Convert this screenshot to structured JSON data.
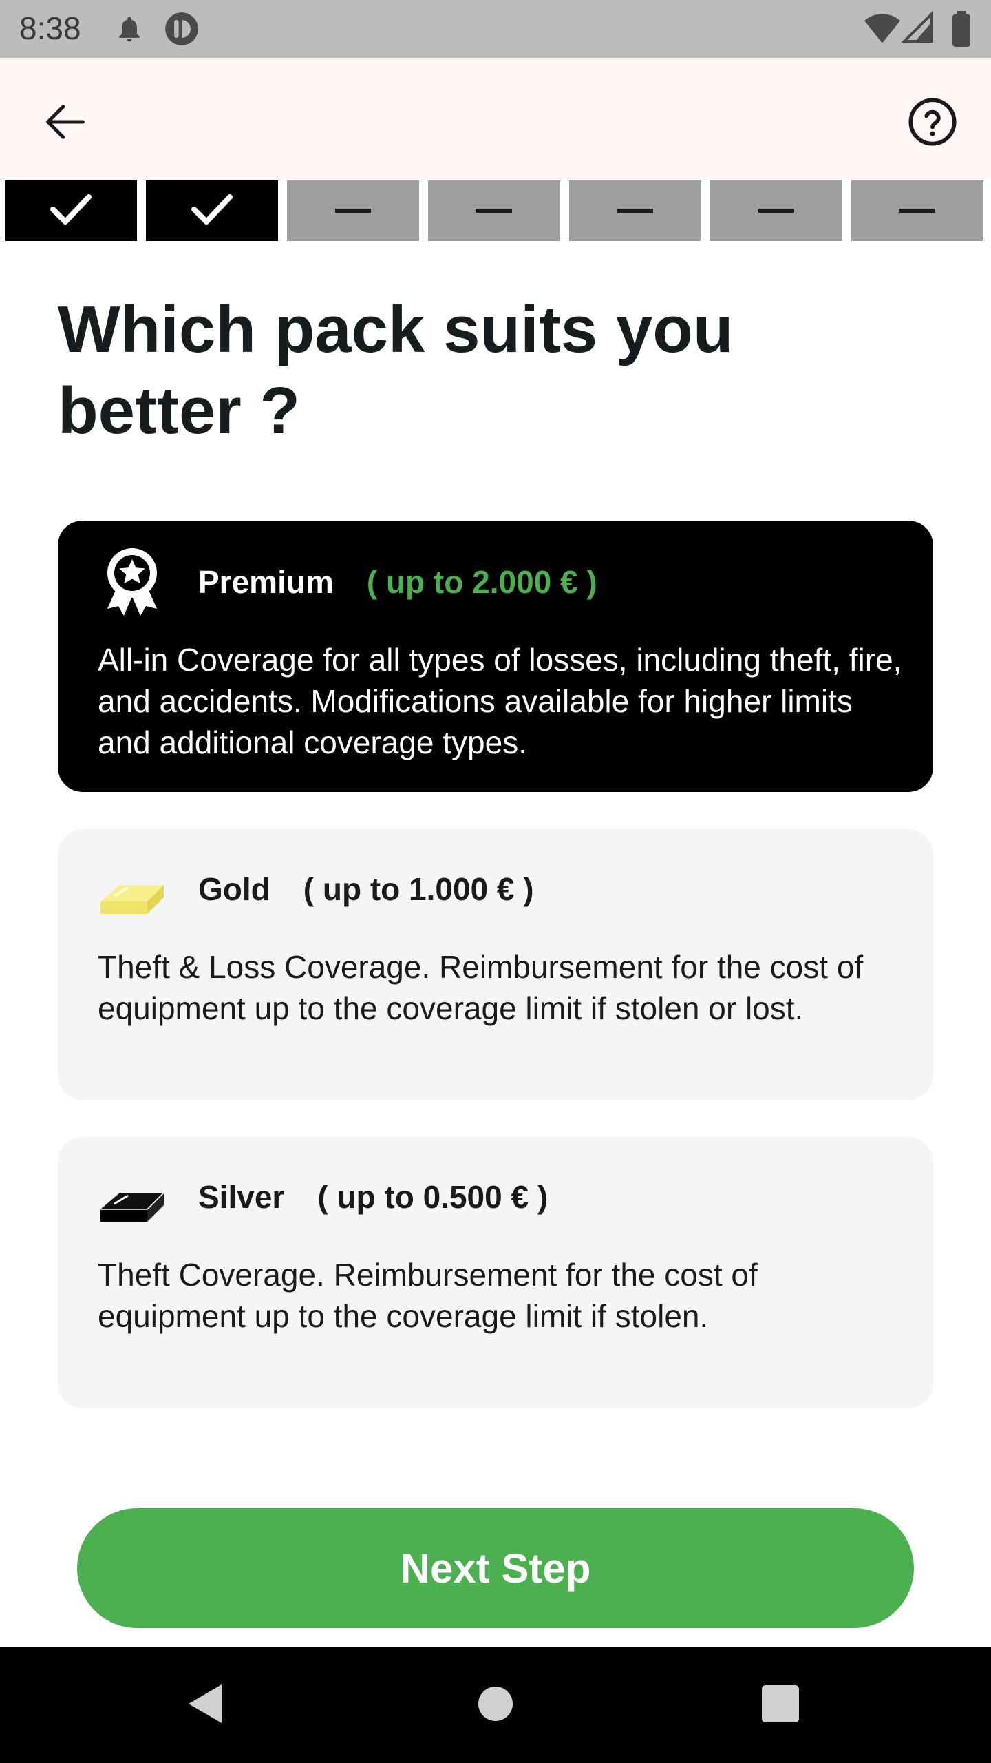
{
  "status_bar": {
    "time": "8:38",
    "icons": [
      "notification-bell-icon",
      "app-badge-icon",
      "wifi-icon",
      "cellular-signal-icon",
      "battery-icon"
    ]
  },
  "app_bar": {
    "back_icon": "arrow-left-icon",
    "help_icon": "help-circle-icon"
  },
  "stepper": {
    "steps": [
      {
        "state": "done",
        "icon": "check-icon"
      },
      {
        "state": "done",
        "icon": "check-icon"
      },
      {
        "state": "todo",
        "icon": "dash-icon"
      },
      {
        "state": "todo",
        "icon": "dash-icon"
      },
      {
        "state": "todo",
        "icon": "dash-icon"
      },
      {
        "state": "todo",
        "icon": "dash-icon"
      },
      {
        "state": "todo",
        "icon": "dash-icon"
      }
    ]
  },
  "page": {
    "title_line1": "Which pack suits you",
    "title_line2": "better ?"
  },
  "packs": [
    {
      "name": "Premium",
      "limit": "( up to 2.000 € )",
      "description": "All-in Coverage for all types of losses, including theft, fire, and accidents. Modifications available for higher limits and additional coverage types.",
      "icon": "award-ribbon-icon",
      "selected": true
    },
    {
      "name": "Gold",
      "limit": "( up to 1.000 € )",
      "description": "Theft & Loss Coverage. Reimbursement for the cost of equipment up to the coverage limit if stolen or lost.",
      "icon": "gold-bar-icon",
      "selected": false
    },
    {
      "name": "Silver",
      "limit": "( up to 0.500 € )",
      "description": "Theft Coverage. Reimbursement for the cost of equipment up to the coverage limit if stolen.",
      "icon": "silver-bar-icon",
      "selected": false
    }
  ],
  "next_button": {
    "label": "Next Step"
  },
  "nav_bar": {
    "back_icon": "nav-back-triangle-icon",
    "home_icon": "nav-home-circle-icon",
    "recents_icon": "nav-recents-square-icon"
  },
  "colors": {
    "accent_green": "#4caf50",
    "selected_card": "#000000",
    "card_bg": "#f5f5f7",
    "app_bar_bg": "#fff8f6",
    "gold": "#f2e86b"
  }
}
